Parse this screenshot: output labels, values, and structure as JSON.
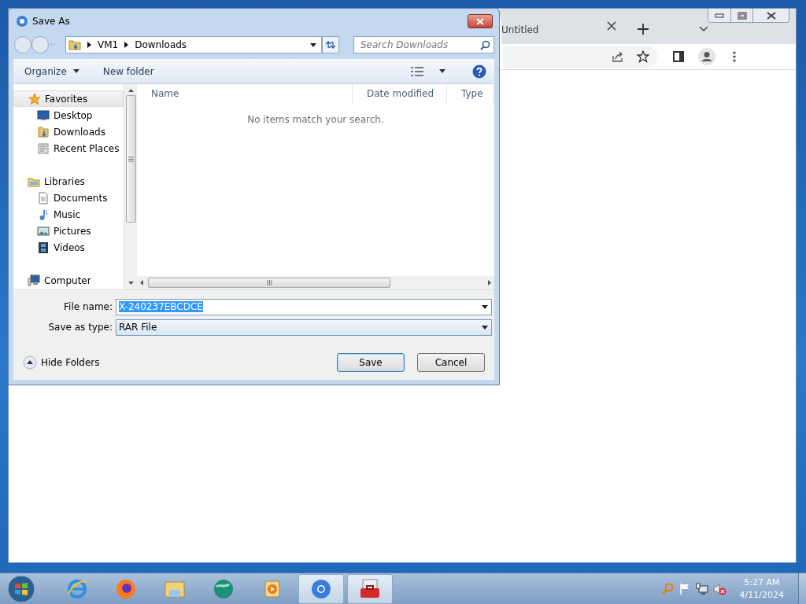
{
  "browser": {
    "tab": {
      "title": "Untitled"
    }
  },
  "dialog": {
    "title": "Save As",
    "breadcrumb": [
      "VM1",
      "Downloads"
    ],
    "search": {
      "placeholder": "Search Downloads"
    },
    "toolbar": [
      "Organize",
      "New folder"
    ],
    "nav": [
      {
        "label": "Favorites",
        "kind": "favorites",
        "selected": true,
        "children": [
          {
            "label": "Desktop",
            "kind": "desktop",
            "selected": false
          },
          {
            "label": "Downloads",
            "kind": "downloads",
            "selected": false
          },
          {
            "label": "Recent Places",
            "kind": "recent",
            "selected": false
          }
        ]
      },
      {
        "label": "Libraries",
        "kind": "libraries",
        "selected": false,
        "children": [
          {
            "label": "Documents",
            "kind": "documents",
            "selected": false
          },
          {
            "label": "Music",
            "kind": "music",
            "selected": false
          },
          {
            "label": "Pictures",
            "kind": "pictures",
            "selected": false
          },
          {
            "label": "Videos",
            "kind": "videos",
            "selected": false
          }
        ]
      },
      {
        "label": "Computer",
        "kind": "computer",
        "selected": false
      }
    ],
    "columns": [
      "Name",
      "Date modified",
      "Type"
    ],
    "empty_message": "No items match your search.",
    "file_name": {
      "label": "File name:",
      "value": "X-240237EBCDCE",
      "text_selected": true
    },
    "save_type": {
      "label": "Save as type:",
      "value": "RAR File"
    },
    "hide_folders": "Hide Folders",
    "buttons": [
      {
        "label": "Save",
        "default": true
      },
      {
        "label": "Cancel",
        "default": false
      }
    ]
  },
  "taskbar": {
    "apps": [
      {
        "kind": "ie",
        "active": false
      },
      {
        "kind": "firefox",
        "active": false
      },
      {
        "kind": "explorer",
        "active": false
      },
      {
        "kind": "globe",
        "active": false
      },
      {
        "kind": "media",
        "active": false
      },
      {
        "kind": "chrome",
        "active": true
      },
      {
        "kind": "toolbox",
        "active": true
      }
    ],
    "clock": {
      "time": "5:27 AM",
      "date": "4/11/2024"
    }
  }
}
